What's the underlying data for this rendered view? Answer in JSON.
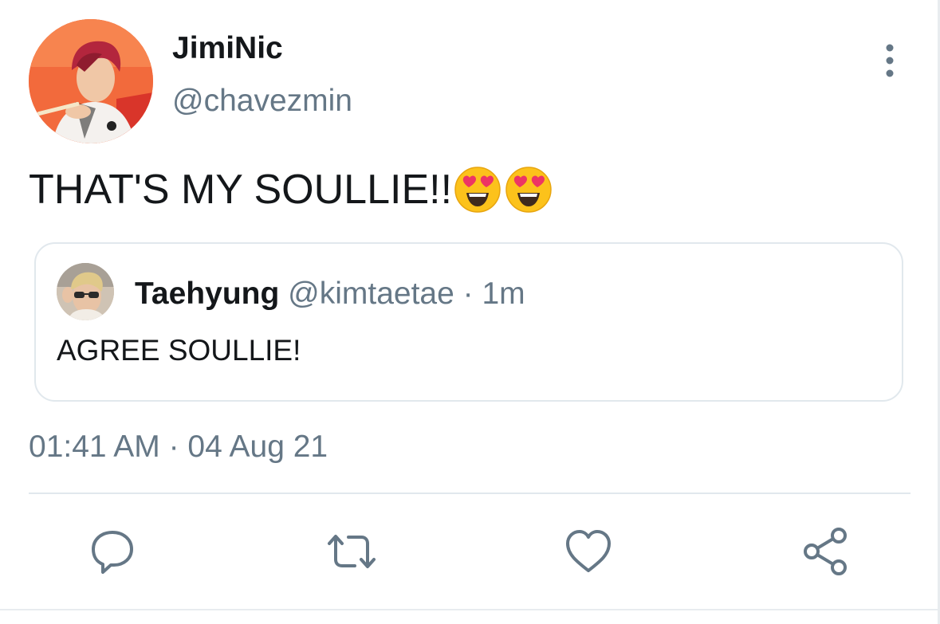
{
  "tweet": {
    "display_name": "JimiNic",
    "handle": "@chavezmin",
    "text": "THAT'S MY SOULLIE!!",
    "emojis": [
      "heart-eyes-emoji",
      "heart-eyes-emoji"
    ],
    "timestamp": "01:41 AM · 04 Aug 21"
  },
  "quoted": {
    "display_name": "Taehyung",
    "meta": " @kimtaetae · 1m",
    "text": "AGREE SOULLIE!"
  },
  "actions": {
    "icons": [
      "reply-icon",
      "retweet-icon",
      "like-icon",
      "share-icon"
    ]
  },
  "colors": {
    "text_primary": "#14171a",
    "text_secondary": "#657786",
    "border": "#e1e8ed",
    "icon": "#657786",
    "avatar_bg": "#f4693a"
  }
}
